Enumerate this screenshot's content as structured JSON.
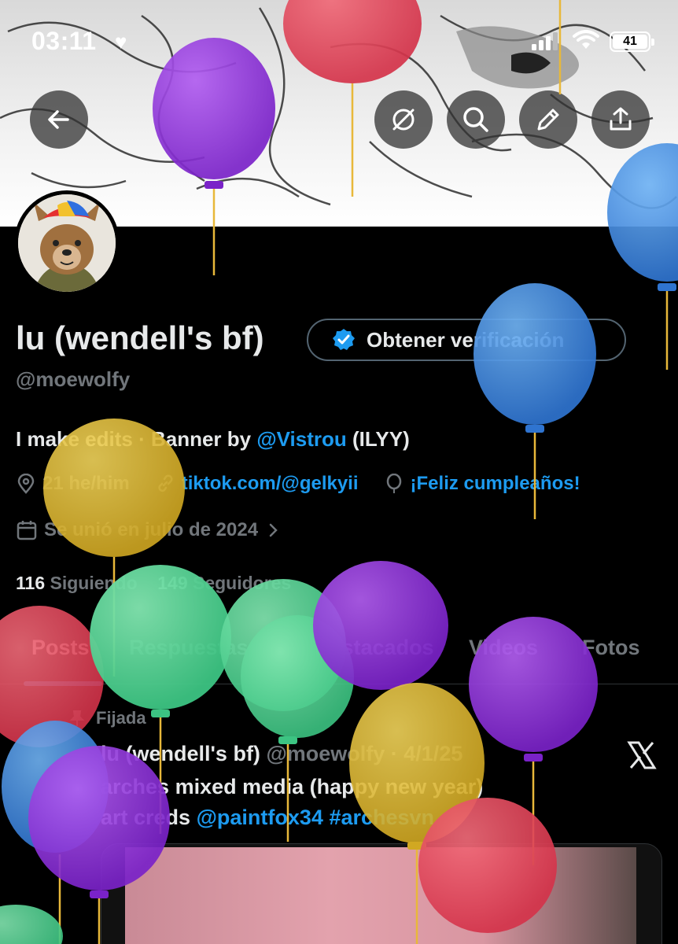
{
  "status_bar": {
    "time": "03:11",
    "battery": "41"
  },
  "header": {
    "back_icon": "arrow-left-icon",
    "actions": [
      "hide-icon",
      "search-icon",
      "edit-icon",
      "share-icon"
    ]
  },
  "profile": {
    "name": "lu (wendell's bf)",
    "verify_label": "Obtener verificación",
    "handle": "@moewolfy",
    "bio_prefix": "I make edits · Banner by ",
    "bio_link": "@Vistrou",
    "bio_suffix": " (ILYY)",
    "location": "21 he/him",
    "website": "tiktok.com/@gelkyii",
    "birthday": "¡Feliz cumpleaños!",
    "joined": "Se unió en julio de 2024",
    "following_count": "116",
    "following_label": "Siguiendo",
    "followers_count": "149",
    "followers_label": "Seguidores"
  },
  "tabs": [
    "Posts",
    "Respuestas",
    "Destacados",
    "Videos",
    "Fotos"
  ],
  "pinned_post": {
    "pinned_label": "Fijada",
    "author": "lu (wendell's bf)",
    "meta": "@moewolfy · 4/1/25",
    "line1": "arches mixed media (happy new year)",
    "line2_prefix": "art creds ",
    "line2_mention": "@paintfox34",
    "line2_tag": " #archesvn"
  },
  "colors": {
    "accent": "#1d9bf0",
    "muted": "#71767b",
    "text": "#e7e9ea",
    "background": "#000000"
  }
}
